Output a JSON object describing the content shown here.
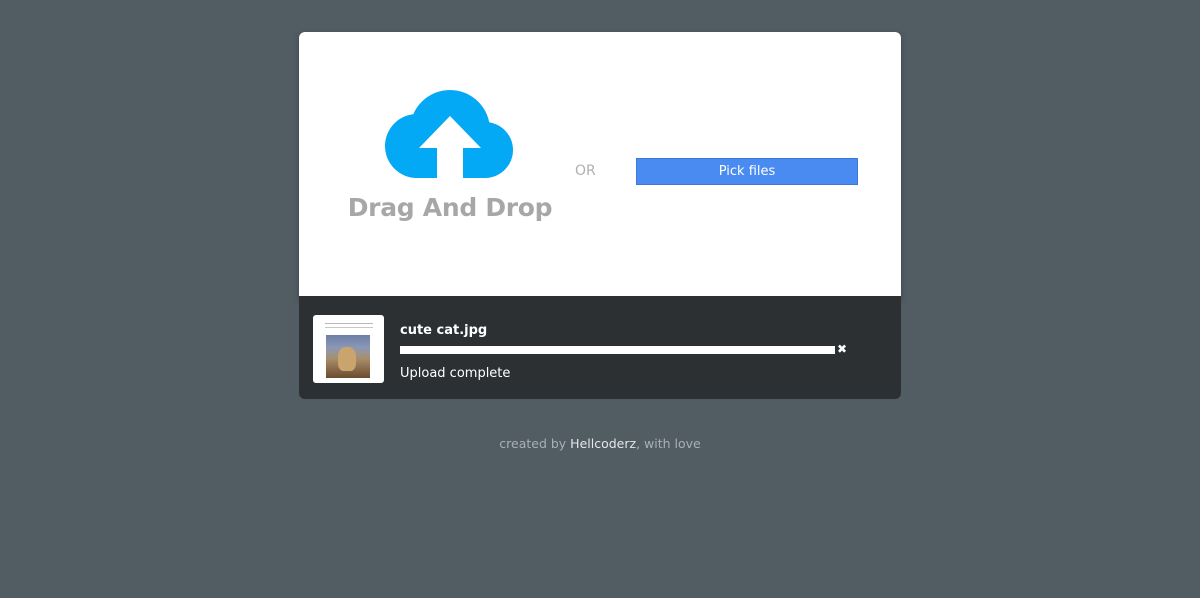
{
  "dropzone": {
    "icon": "cloud-upload-icon",
    "label": "Drag And Drop"
  },
  "or_text": "OR",
  "pick_button": {
    "label": "Pick files"
  },
  "upload": {
    "file_name": "cute cat.jpg",
    "progress_fraction": 1.0,
    "status": "Upload complete",
    "remove_icon": "close-icon",
    "remove_glyph": "✖"
  },
  "footer": {
    "prefix": "created by",
    "link": "Hellcoderz",
    "suffix": ", with love"
  },
  "colors": {
    "background": "#525c63",
    "cloud": "#03a9f4",
    "button": "#4a8bf1",
    "panel": "#2c3033"
  }
}
